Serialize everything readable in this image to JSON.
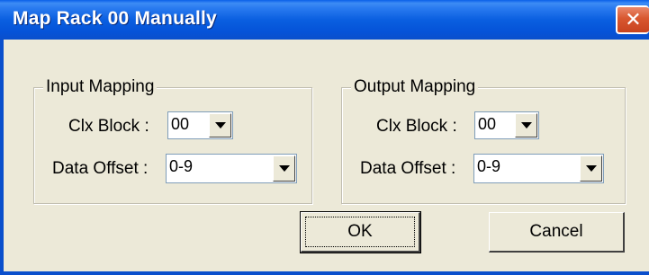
{
  "window": {
    "title": "Map Rack 00 Manually",
    "close_glyph": "✕"
  },
  "input_mapping": {
    "group_label": "Input Mapping",
    "clx_block_label": "Clx Block :",
    "clx_block_value": "00",
    "data_offset_label": "Data Offset :",
    "data_offset_value": "0-9"
  },
  "output_mapping": {
    "group_label": "Output Mapping",
    "clx_block_label": "Clx Block :",
    "clx_block_value": "00",
    "data_offset_label": "Data Offset :",
    "data_offset_value": "0-9"
  },
  "buttons": {
    "ok_label": "OK",
    "cancel_label": "Cancel"
  },
  "colors": {
    "titlebar": "#0a5fe0",
    "dialog_bg": "#ece9d8",
    "close_button": "#d8572f"
  }
}
